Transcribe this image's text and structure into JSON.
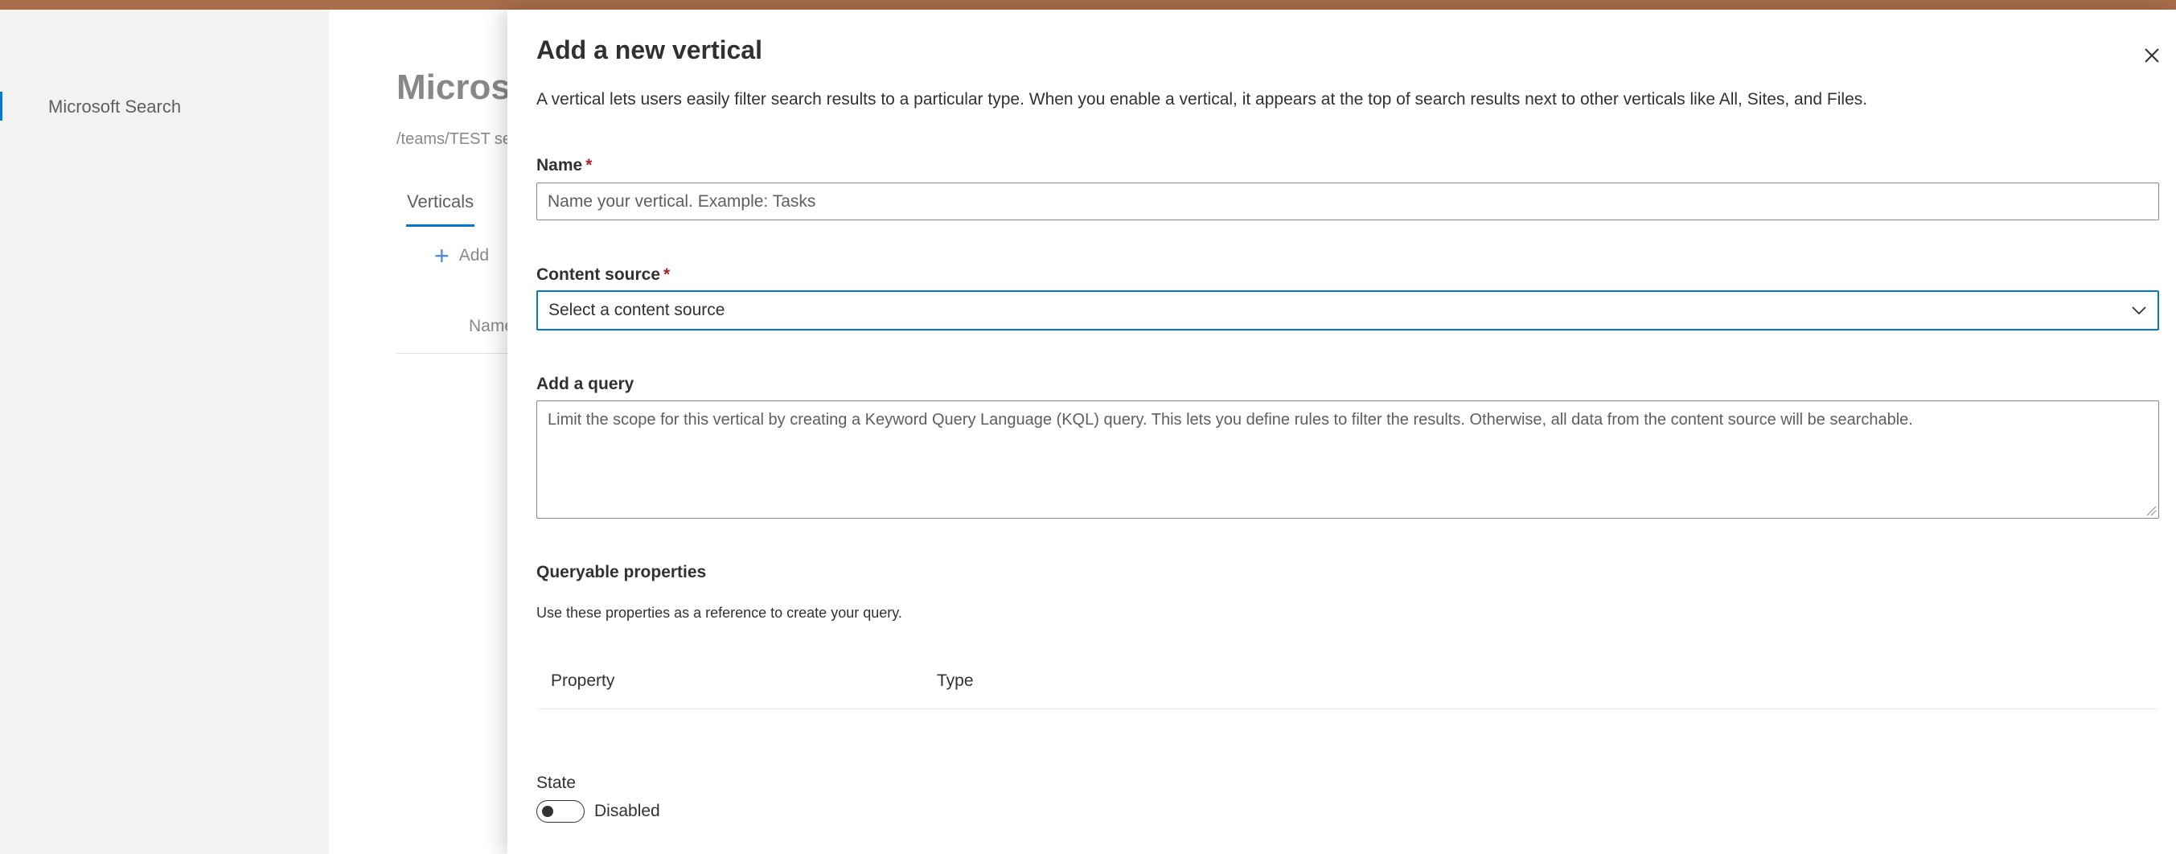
{
  "left_nav": {
    "items": [
      {
        "label": "Microsoft Search"
      }
    ]
  },
  "background": {
    "title": "Microsoft Search",
    "path": "/teams/TEST search",
    "tab": "Verticals",
    "add_label": "Add",
    "column_name": "Name"
  },
  "panel": {
    "title": "Add a new vertical",
    "description": "A vertical lets users easily filter search results to a particular type. When you enable a vertical, it appears at the top of search results next to other verticals like All, Sites, and Files.",
    "name_field": {
      "label": "Name",
      "required_marker": "*",
      "placeholder": "Name your vertical. Example: Tasks"
    },
    "content_source": {
      "label": "Content source",
      "required_marker": "*",
      "value": "Select a content source"
    },
    "query": {
      "label": "Add a query",
      "placeholder": "Limit the scope for this vertical by creating a Keyword Query Language (KQL) query. This lets you define rules to filter the results. Otherwise, all data from the content source will be searchable."
    },
    "queryable": {
      "heading": "Queryable properties",
      "helper": "Use these properties as a reference to create your query.",
      "columns": [
        "Property",
        "Type"
      ]
    },
    "state": {
      "label": "State",
      "toggle_text": "Disabled",
      "enabled": false
    }
  },
  "colors": {
    "accent": "#0078d4",
    "top_bar": "#a86e4a",
    "required": "#a4262c"
  },
  "icons": {
    "close": "close-icon",
    "dropdown": "chevron-down-icon",
    "add": "plus-icon"
  }
}
